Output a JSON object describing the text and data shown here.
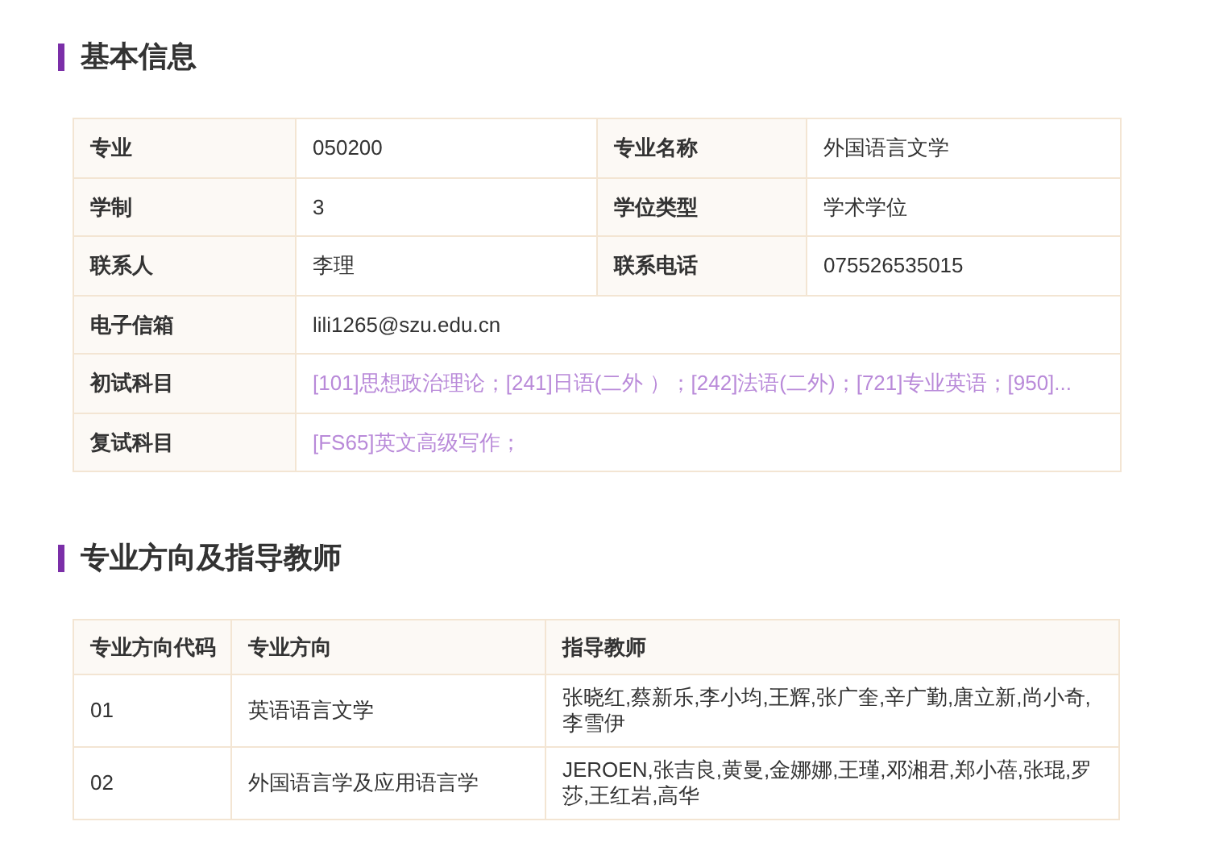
{
  "basic_info": {
    "title": "基本信息",
    "rows": [
      {
        "cells": [
          {
            "kind": "label",
            "text": "专业"
          },
          {
            "kind": "value",
            "text": "050200"
          },
          {
            "kind": "label",
            "text": "专业名称"
          },
          {
            "kind": "value",
            "text": "外国语言文学"
          }
        ]
      },
      {
        "cells": [
          {
            "kind": "label",
            "text": "学制"
          },
          {
            "kind": "value",
            "text": "3"
          },
          {
            "kind": "label",
            "text": "学位类型"
          },
          {
            "kind": "value",
            "text": "学术学位"
          }
        ]
      },
      {
        "cells": [
          {
            "kind": "label",
            "text": "联系人"
          },
          {
            "kind": "value",
            "text": "李理"
          },
          {
            "kind": "label",
            "text": "联系电话"
          },
          {
            "kind": "value",
            "text": "075526535015"
          }
        ]
      },
      {
        "cells": [
          {
            "kind": "label",
            "text": "电子信箱"
          },
          {
            "kind": "value",
            "text": "lili1265@szu.edu.cn",
            "colspan": 3
          }
        ]
      },
      {
        "cells": [
          {
            "kind": "label",
            "text": "初试科目"
          },
          {
            "kind": "link",
            "text": "[101]思想政治理论；[241]日语(二外 ）；[242]法语(二外)；[721]专业英语；[950]...",
            "colspan": 3
          }
        ]
      },
      {
        "cells": [
          {
            "kind": "label",
            "text": "复试科目"
          },
          {
            "kind": "link",
            "text": "[FS65]英文高级写作；",
            "colspan": 3
          }
        ]
      }
    ]
  },
  "directions": {
    "title": "专业方向及指导教师",
    "columns": [
      "专业方向代码",
      "专业方向",
      "指导教师"
    ],
    "rows": [
      [
        "01",
        "英语语言文学",
        "张晓红,蔡新乐,李小均,王辉,张广奎,辛广勤,唐立新,尚小奇,李雪伊"
      ],
      [
        "02",
        "外国语言学及应用语言学",
        "JEROEN,张吉良,黄曼,金娜娜,王瑾,邓湘君,郑小蓓,张琨,罗莎,王红岩,高华"
      ]
    ]
  }
}
